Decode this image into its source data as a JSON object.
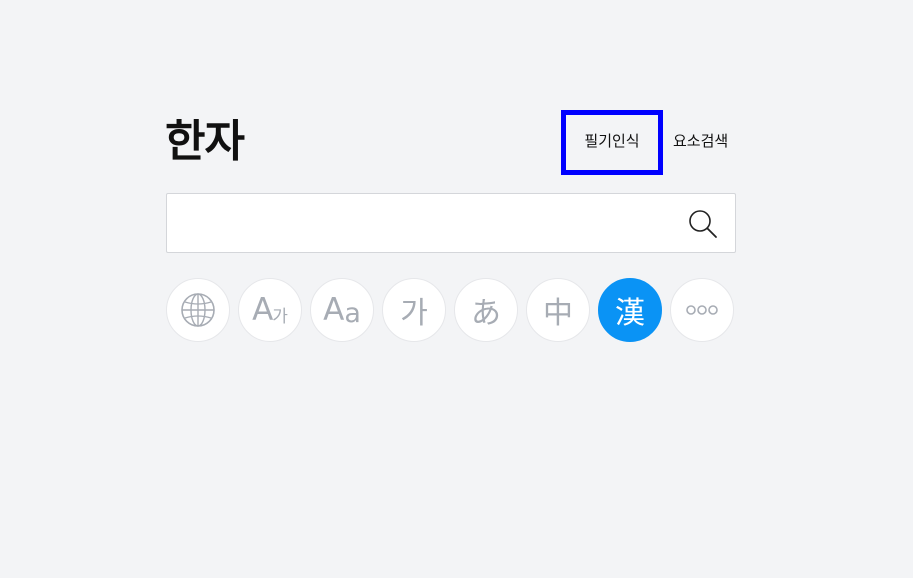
{
  "header": {
    "title": "한자"
  },
  "tools": {
    "handwriting_label": "필기인식",
    "element_search_label": "요소검색"
  },
  "search": {
    "value": "",
    "placeholder": ""
  },
  "lang_buttons": [
    {
      "name": "global",
      "icon": "globe-icon"
    },
    {
      "name": "english-korean",
      "main": "A",
      "sub": "가"
    },
    {
      "name": "english",
      "main": "A",
      "sub": "a"
    },
    {
      "name": "korean",
      "label": "가"
    },
    {
      "name": "japanese",
      "label": "あ"
    },
    {
      "name": "chinese",
      "label": "中"
    },
    {
      "name": "hanja",
      "label": "漢",
      "active": true
    },
    {
      "name": "more",
      "label": "ooo"
    }
  ],
  "colors": {
    "background": "#f3f4f6",
    "active": "#0a93f5",
    "highlight_border": "#0000ff",
    "icon_gray": "#a7acb4"
  }
}
